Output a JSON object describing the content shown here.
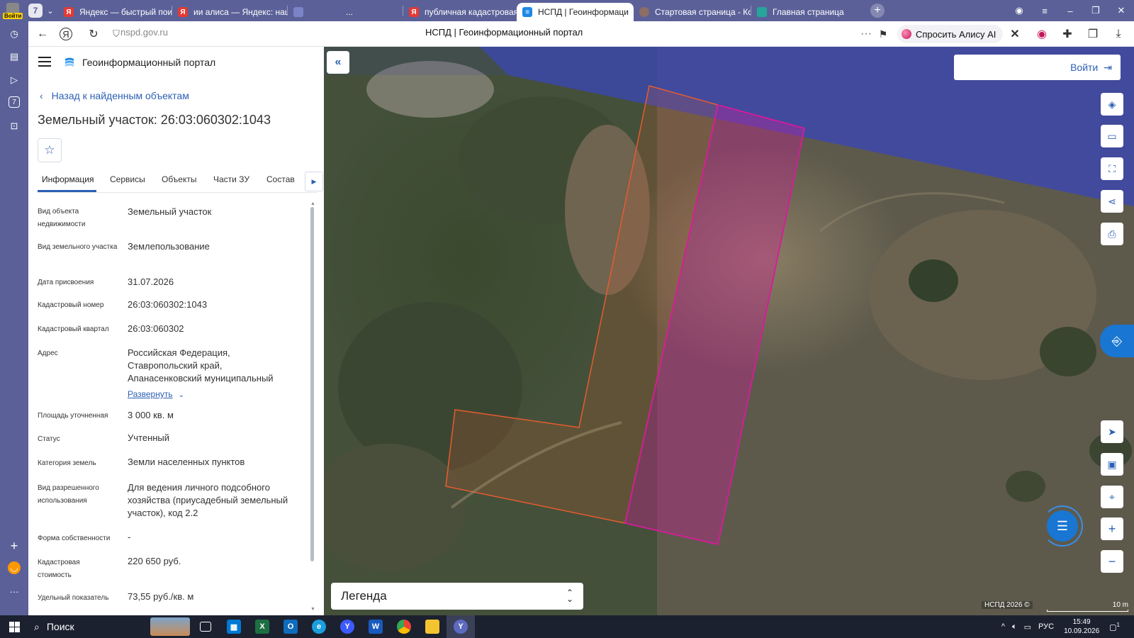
{
  "browser": {
    "profile_tag": "Войти",
    "tab_group_count": "7",
    "tabs": [
      {
        "title": "Яндекс — быстрый поиск",
        "fav_color": "#e53935",
        "fav": "Я"
      },
      {
        "title": "ии алиса — Яндекс: нашл",
        "fav_color": "#e53935",
        "fav": "Я"
      },
      {
        "title": "...",
        "fav_color": "#7c84c9",
        "fav": ""
      },
      {
        "title": "публичная кадастровая к",
        "fav_color": "#e53935",
        "fav": "Я"
      },
      {
        "title": "НСПД | Геоинформаци",
        "fav_color": "#1e88e5",
        "fav": "≡"
      },
      {
        "title": "Стартовая страница - Ко",
        "fav_color": "#8d6e63",
        "fav": ""
      },
      {
        "title": "Главная страница",
        "fav_color": "#26a69a",
        "fav": ""
      }
    ],
    "url": "nspd.gov.ru",
    "page_title": "НСПД | Геоинформационный портал",
    "alice_label": "Спросить Алису AI"
  },
  "app": {
    "portal_title": "Геоинформационный портал",
    "back_label": "Назад к найденным объектам",
    "object_title": "Земельный участок: 26:03:060302:1043",
    "tabs": [
      "Информация",
      "Сервисы",
      "Объекты",
      "Части ЗУ",
      "Состав"
    ],
    "properties": [
      {
        "label": "Вид объекта недвижимости",
        "value": "Земельный участок"
      },
      {
        "label": "Вид земельного участка",
        "value": "Землепользование"
      },
      {
        "label": "Дата присвоения",
        "value": "31.07.2026"
      },
      {
        "label": "Кадастровый номер",
        "value": "26:03:060302:1043"
      },
      {
        "label": "Кадастровый квартал",
        "value": "26:03:060302"
      },
      {
        "label": "Адрес",
        "value": "Российская Федерация, Ставропольский край, Апанасенковский муниципальный"
      },
      {
        "label": "Площадь уточненная",
        "value": "3 000 кв. м"
      },
      {
        "label": "Статус",
        "value": "Учтенный"
      },
      {
        "label": "Категория земель",
        "value": "Земли населенных пунктов"
      },
      {
        "label": "Вид разрешенного использования",
        "value": "Для ведения личного подсобного хозяйства (приусадебный земельный участок), код 2.2"
      },
      {
        "label": "Форма собственности",
        "value": "-"
      },
      {
        "label": "Кадастровая стоимость",
        "value": "220 650 руб."
      },
      {
        "label": "Удельный показатель",
        "value": "73,55 руб./кв. м"
      }
    ],
    "expand_label": "Развернуть"
  },
  "map": {
    "login_label": "Войти",
    "legend_label": "Легенда",
    "copyright": "НСПД 2026 ©",
    "scale_label": "10 m",
    "tools": [
      "layers-icon",
      "ruler-icon",
      "select-area-icon",
      "share-icon",
      "print-icon",
      "locate-icon",
      "minimap-icon",
      "search-location-icon",
      "zoom-in-icon",
      "zoom-out-icon"
    ],
    "parcel_colors": {
      "selected": "#d81b9a",
      "neighbor": "#e65c2e"
    }
  },
  "taskbar": {
    "search_label": "Поиск",
    "lang": "РУС",
    "time": "15:49",
    "date": "10.09.2026",
    "notif_count": "1"
  }
}
